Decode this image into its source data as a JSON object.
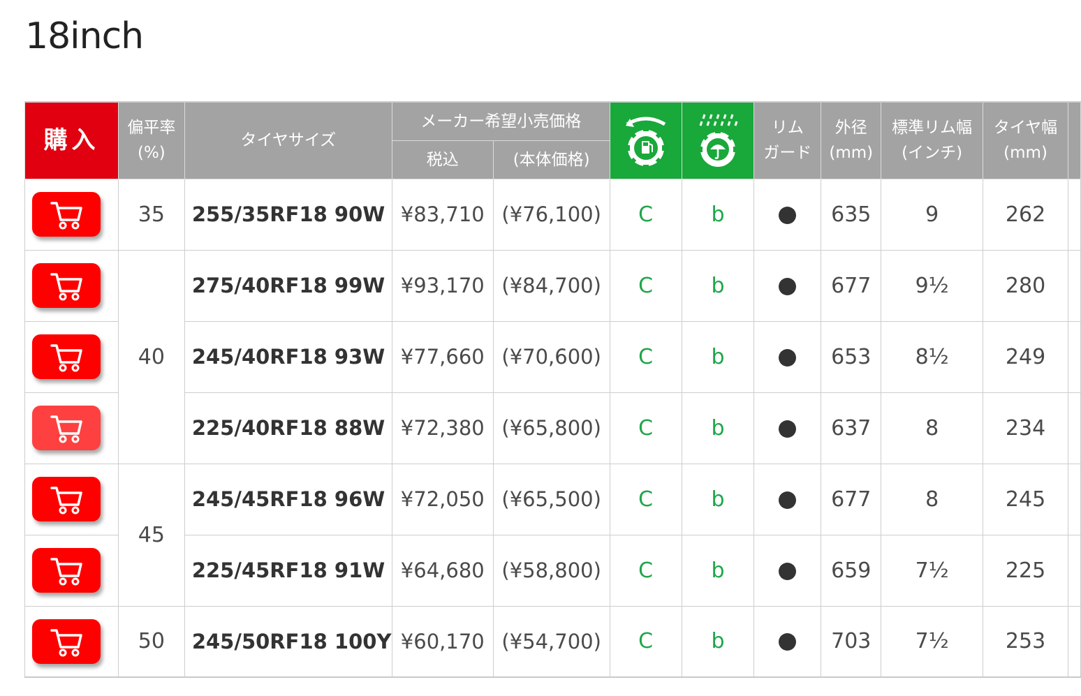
{
  "page": {
    "title": "18inch"
  },
  "header": {
    "buy": "購入",
    "aspect": [
      "偏平率",
      "(%)"
    ],
    "size": "タイヤサイズ",
    "price_group": "メーカー希望小売価格",
    "price_incl": "税込",
    "price_excl": "(本体価格)",
    "rim_guard": [
      "リム",
      "ガード"
    ],
    "outer_diameter": [
      "外径",
      "(mm)"
    ],
    "rim_width": [
      "標準リム幅",
      "(インチ)"
    ],
    "tire_width": [
      "タイヤ幅",
      "(mm)"
    ],
    "fuel_icon": "fuel-efficiency-label-icon",
    "wet_icon": "wet-grip-label-icon"
  },
  "colors": {
    "buy": "#e0000f",
    "cart": "#ff0000",
    "label_green": "#19a83a",
    "header_gray": "#a3a3a3",
    "grade_text": "#1ea64a"
  },
  "aspect_groups": [
    "35",
    "40",
    "45",
    "50"
  ],
  "rows": [
    {
      "size": "255/35RF18 90W",
      "price_incl": "¥83,710",
      "price_excl": "(¥76,100)",
      "fuel": "C",
      "wet": "b",
      "rim_guard": "●",
      "outer": "635",
      "rim_width": "9",
      "tire_width": "262"
    },
    {
      "size": "275/40RF18 99W",
      "price_incl": "¥93,170",
      "price_excl": "(¥84,700)",
      "fuel": "C",
      "wet": "b",
      "rim_guard": "●",
      "outer": "677",
      "rim_width": "9½",
      "tire_width": "280"
    },
    {
      "size": "245/40RF18 93W",
      "price_incl": "¥77,660",
      "price_excl": "(¥70,600)",
      "fuel": "C",
      "wet": "b",
      "rim_guard": "●",
      "outer": "653",
      "rim_width": "8½",
      "tire_width": "249"
    },
    {
      "size": "225/40RF18 88W",
      "price_incl": "¥72,380",
      "price_excl": "(¥65,800)",
      "fuel": "C",
      "wet": "b",
      "rim_guard": "●",
      "outer": "637",
      "rim_width": "8",
      "tire_width": "234"
    },
    {
      "size": "245/45RF18 96W",
      "price_incl": "¥72,050",
      "price_excl": "(¥65,500)",
      "fuel": "C",
      "wet": "b",
      "rim_guard": "●",
      "outer": "677",
      "rim_width": "8",
      "tire_width": "245"
    },
    {
      "size": "225/45RF18 91W",
      "price_incl": "¥64,680",
      "price_excl": "(¥58,800)",
      "fuel": "C",
      "wet": "b",
      "rim_guard": "●",
      "outer": "659",
      "rim_width": "7½",
      "tire_width": "225"
    },
    {
      "size": "245/50RF18 100Y",
      "price_incl": "¥60,170",
      "price_excl": "(¥54,700)",
      "fuel": "C",
      "wet": "b",
      "rim_guard": "●",
      "outer": "703",
      "rim_width": "7½",
      "tire_width": "253"
    }
  ]
}
